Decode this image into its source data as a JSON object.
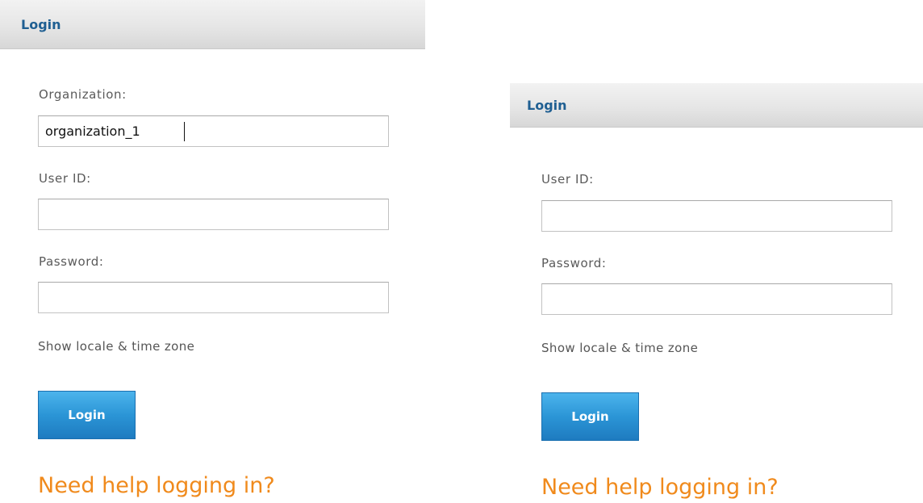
{
  "left_form": {
    "header_title": "Login",
    "organization_label": "Organization:",
    "organization_value": "organization_1",
    "user_id_label": "User ID:",
    "user_id_value": "",
    "password_label": "Password:",
    "password_value": "",
    "locale_link": "Show locale & time zone",
    "login_button": "Login",
    "help_link": "Need help logging in?"
  },
  "right_form": {
    "header_title": "Login",
    "user_id_label": "User ID:",
    "user_id_value": "",
    "password_label": "Password:",
    "password_value": "",
    "locale_link": "Show locale & time zone",
    "login_button": "Login",
    "help_link": "Need help logging in?"
  },
  "colors": {
    "header_title": "#1f5f92",
    "button_blue": "#2b95d6",
    "help_link_orange": "#f08a1c",
    "label_gray": "#5a5a5a"
  }
}
